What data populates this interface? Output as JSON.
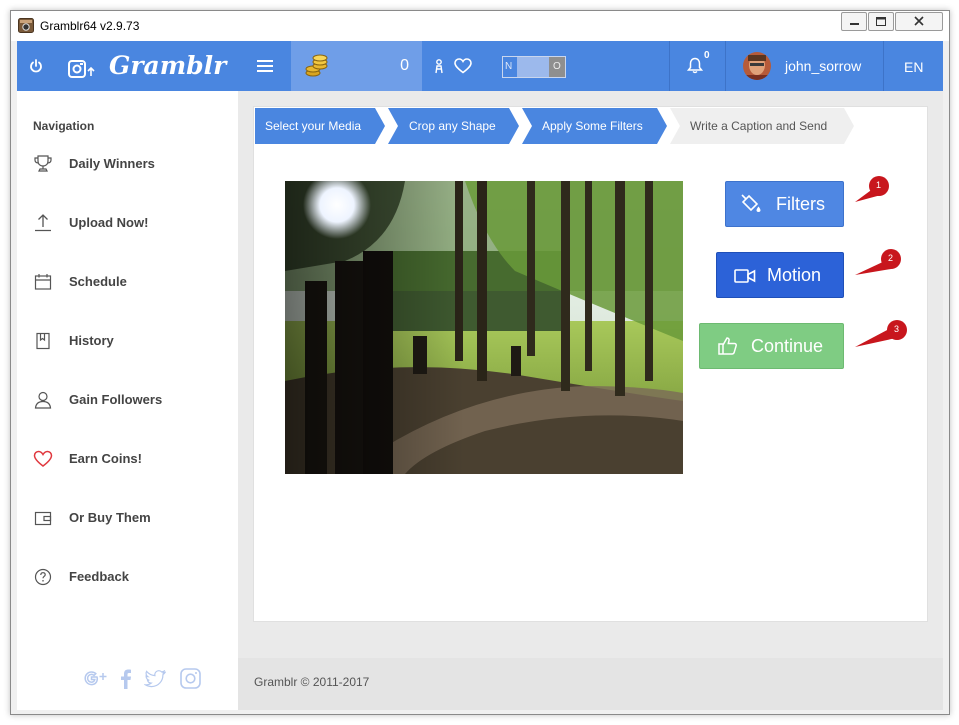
{
  "window": {
    "title": "Gramblr64 v2.9.73"
  },
  "topbar": {
    "brand": "Gramblr",
    "coins": "0",
    "toggle_left": "N",
    "toggle_right": "O",
    "notifications_count": "0",
    "username": "john_sorrow",
    "language": "EN"
  },
  "sidebar": {
    "heading": "Navigation",
    "items": [
      {
        "label": "Daily Winners",
        "icon": "trophy-icon"
      },
      {
        "label": "Upload Now!",
        "icon": "upload-icon"
      },
      {
        "label": "Schedule",
        "icon": "calendar-icon"
      },
      {
        "label": "History",
        "icon": "bookmark-icon"
      },
      {
        "label": "Gain Followers",
        "icon": "user-icon"
      },
      {
        "label": "Earn Coins!",
        "icon": "heart-icon"
      },
      {
        "label": "Or Buy Them",
        "icon": "wallet-icon"
      },
      {
        "label": "Feedback",
        "icon": "help-icon"
      }
    ]
  },
  "steps": [
    {
      "label": "Select your Media",
      "state": "done"
    },
    {
      "label": "Crop any Shape",
      "state": "done"
    },
    {
      "label": "Apply Some Filters",
      "state": "done"
    },
    {
      "label": "Write a Caption and Send",
      "state": "current"
    }
  ],
  "actions": {
    "filters": "Filters",
    "motion": "Motion",
    "continue": "Continue"
  },
  "callouts": [
    "1",
    "2",
    "3"
  ],
  "footer": {
    "copyright": "Gramblr © 2011-2017"
  },
  "colors": {
    "brand_blue": "#4a86e0",
    "step_blue": "#4a86e0",
    "filters_btn": "#4f87e3",
    "motion_btn": "#2c62d8",
    "continue_btn": "#7fcc83",
    "callout_red": "#c8161d",
    "heart_red": "#e0383e"
  }
}
